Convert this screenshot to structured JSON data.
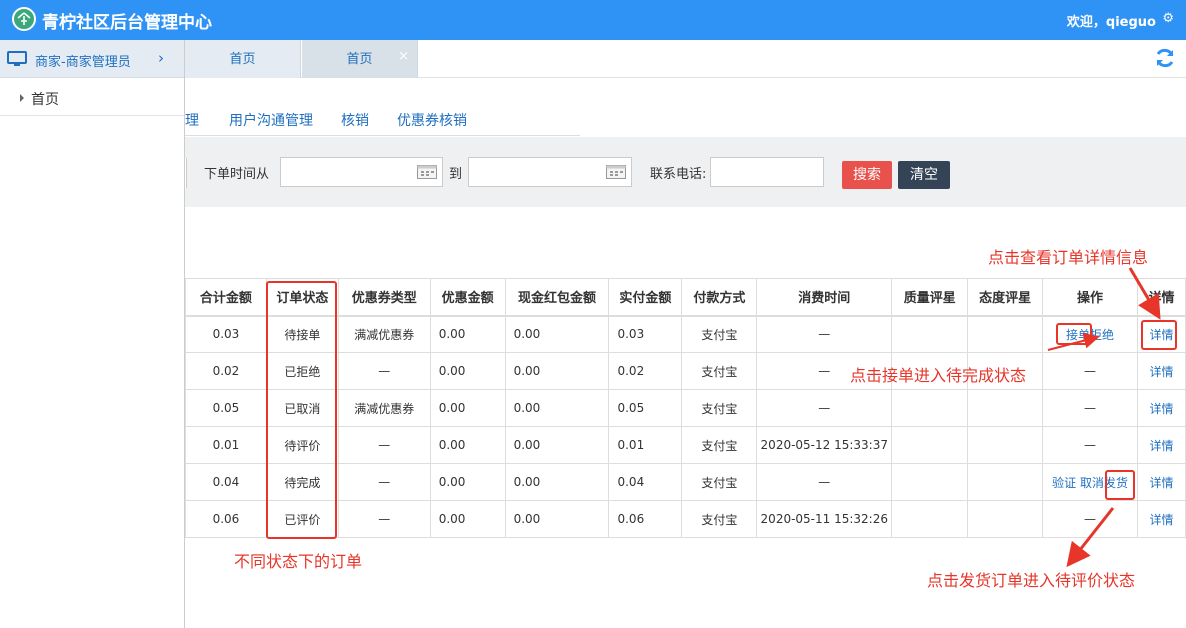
{
  "header": {
    "title": "青柠社区后台管理中心",
    "welcome": "欢迎，qieguo",
    "gear_icon": "gear-icon"
  },
  "sidebar": {
    "group_label": "商家-商家管理员",
    "items": [
      {
        "label": "首页"
      }
    ]
  },
  "tabs": [
    {
      "label": "首页"
    },
    {
      "label": "首页",
      "close": "×"
    }
  ],
  "subtabs": [
    {
      "label": "理"
    },
    {
      "label": "用户沟通管理"
    },
    {
      "label": "核销"
    },
    {
      "label": "优惠券核销"
    }
  ],
  "filter": {
    "order_time_from_label": "下单时间从",
    "to_label": "到",
    "phone_label": "联系电话:",
    "order_time_from_value": "",
    "order_time_to_value": "",
    "phone_value": "",
    "search_button": "搜索",
    "clear_button": "清空"
  },
  "table": {
    "columns": [
      "合计金额",
      "订单状态",
      "优惠券类型",
      "优惠金额",
      "现金红包金额",
      "实付金额",
      "付款方式",
      "消费时间",
      "质量评星",
      "态度评星",
      "操作",
      "详情"
    ],
    "rows": [
      {
        "total": "0.03",
        "status": "待接单",
        "coupon_type": "满减优惠券",
        "discount": "0.00",
        "red_packet": "0.00",
        "paid": "0.03",
        "pay_method": "支付宝",
        "time": "—",
        "quality": "",
        "attitude": "",
        "ops": [
          "接单",
          "拒绝"
        ],
        "detail": "详情"
      },
      {
        "total": "0.02",
        "status": "已拒绝",
        "coupon_type": "—",
        "discount": "0.00",
        "red_packet": "0.00",
        "paid": "0.02",
        "pay_method": "支付宝",
        "time": "—",
        "quality": "",
        "attitude": "",
        "ops_text": "—",
        "detail": "详情"
      },
      {
        "total": "0.05",
        "status": "已取消",
        "coupon_type": "满减优惠券",
        "discount": "0.00",
        "red_packet": "0.00",
        "paid": "0.05",
        "pay_method": "支付宝",
        "time": "—",
        "quality": "",
        "attitude": "",
        "ops_text": "—",
        "detail": "详情"
      },
      {
        "total": "0.01",
        "status": "待评价",
        "coupon_type": "—",
        "discount": "0.00",
        "red_packet": "0.00",
        "paid": "0.01",
        "pay_method": "支付宝",
        "time": "2020-05-12 15:33:37",
        "quality": "",
        "attitude": "",
        "ops_text": "—",
        "detail": "详情"
      },
      {
        "total": "0.04",
        "status": "待完成",
        "coupon_type": "—",
        "discount": "0.00",
        "red_packet": "0.00",
        "paid": "0.04",
        "pay_method": "支付宝",
        "time": "—",
        "quality": "",
        "attitude": "",
        "ops": [
          "验证",
          "取消",
          "发货"
        ],
        "detail": "详情"
      },
      {
        "total": "0.06",
        "status": "已评价",
        "coupon_type": "—",
        "discount": "0.00",
        "red_packet": "0.00",
        "paid": "0.06",
        "pay_method": "支付宝",
        "time": "2020-05-11 15:32:26",
        "quality": "",
        "attitude": "",
        "ops_text": "—",
        "detail": "详情"
      }
    ]
  },
  "annotations": {
    "detail_hint": "点击查看订单详情信息",
    "accept_hint": "点击接单进入待完成状态",
    "status_hint": "不同状态下的订单",
    "ship_hint": "点击发货订单进入待评价状态"
  },
  "colors": {
    "header_bg": "#2f93f5",
    "link": "#1f6fc0",
    "annotation": "#e8352a",
    "search_btn": "#e8514c",
    "clear_btn": "#344456"
  }
}
